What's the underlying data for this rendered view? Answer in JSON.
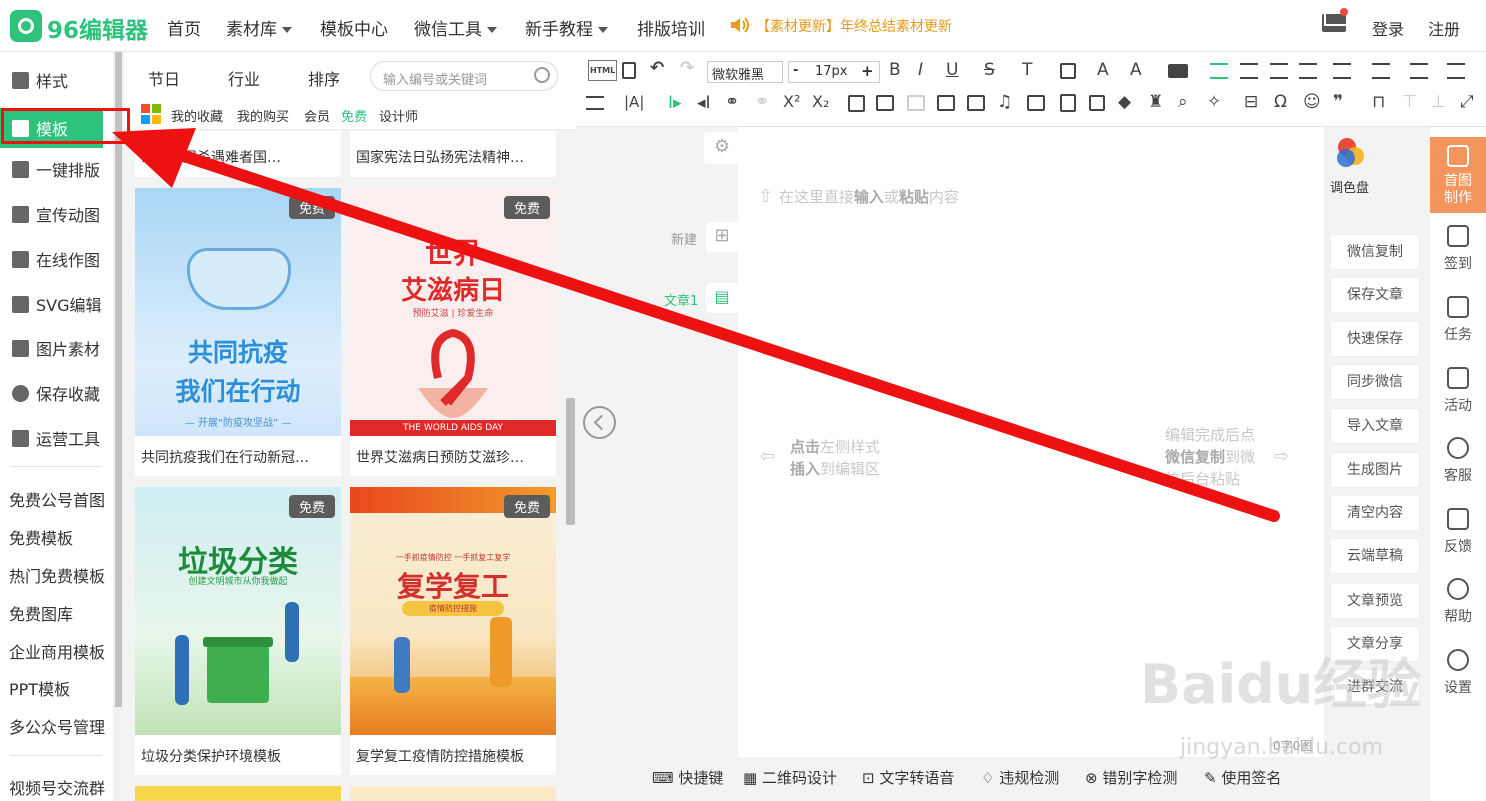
{
  "brand": {
    "logo_text": "96编辑器",
    "accent": "#2ec37c"
  },
  "topnav": {
    "items": [
      {
        "label": "首页",
        "dropdown": false
      },
      {
        "label": "素材库",
        "dropdown": true
      },
      {
        "label": "模板中心",
        "dropdown": false
      },
      {
        "label": "微信工具",
        "dropdown": true
      },
      {
        "label": "新手教程",
        "dropdown": true
      },
      {
        "label": "排版培训",
        "dropdown": false
      }
    ],
    "news": "【素材更新】年终总结素材更新",
    "login": "登录",
    "register": "注册"
  },
  "sidebar": {
    "items": [
      {
        "label": "样式",
        "icon": "grid-icon"
      },
      {
        "label": "模板",
        "icon": "layers-icon",
        "active": true
      },
      {
        "label": "一键排版",
        "icon": "copy-icon"
      },
      {
        "label": "宣传动图",
        "icon": "gif-icon"
      },
      {
        "label": "在线作图",
        "icon": "edit-icon"
      },
      {
        "label": "SVG编辑",
        "icon": "cursor-icon"
      },
      {
        "label": "图片素材",
        "icon": "image-icon"
      },
      {
        "label": "保存收藏",
        "icon": "heart-icon"
      },
      {
        "label": "运营工具",
        "icon": "apps-icon"
      }
    ],
    "links": [
      "免费公号首图",
      "免费模板",
      "热门免费模板",
      "免费图库",
      "企业商用模板",
      "PPT模板",
      "多公众号管理"
    ],
    "bottom_link": "视频号交流群"
  },
  "template_panel": {
    "tabs": [
      "节日",
      "行业",
      "排序"
    ],
    "search_placeholder": "输入编号或关键词",
    "subtabs": [
      "我的收藏",
      "我的购买",
      "会员",
      "免费",
      "设计师"
    ],
    "top_cards": [
      "…京大屠杀遇难者国…",
      "国家宪法日弘扬宪法精神…"
    ],
    "cards": [
      {
        "title": "共同抗疫我们在行动新冠…",
        "badge": "免费",
        "poster_title": "共同抗疫",
        "poster_title2": "我们在行动",
        "poster_sub": "— 开展“防疫攻坚战” —"
      },
      {
        "title": "世界艾滋病日预防艾滋珍…",
        "badge": "免费",
        "poster_title": "世界",
        "poster_title2": "艾滋病日",
        "poster_sub": "预防艾滋 | 珍爱生命",
        "poster_band": "THE WORLD AIDS DAY"
      },
      {
        "title": "垃圾分类保护环境模板",
        "badge": "免费",
        "poster_title": "垃圾分类",
        "poster_sub": "创建文明城市从你我做起"
      },
      {
        "title": "复学复工疫情防控措施模板",
        "badge": "免费",
        "poster_title": "复学复工",
        "poster_top": "一手抓疫情防控 一手抓复工复学",
        "poster_sub": "疫情防控措施"
      }
    ]
  },
  "toolbar": {
    "font_family": "微软雅黑",
    "font_size": "17px",
    "html_label": "HTML"
  },
  "editor": {
    "new_label": "新建",
    "article_label": "文章1",
    "top_hint_pre": "在这里直接",
    "top_hint_bold1": "输入",
    "top_hint_mid": "或",
    "top_hint_bold2": "粘贴",
    "top_hint_post": "内容",
    "left_hint_line1_bold": "点击",
    "left_hint_line1": "左侧样式",
    "left_hint_line2_bold": "插入",
    "left_hint_line2": "到编辑区",
    "right_hint_line1": "编辑完成后点",
    "right_hint_line2_bold": "微信复制",
    "right_hint_line2": "到微",
    "right_hint_line3": "信后台粘贴",
    "word_count": "0字0图"
  },
  "bottombar": [
    "快捷键",
    "二维码设计",
    "文字转语音",
    "违规检测",
    "错别字检测",
    "使用签名"
  ],
  "right_actions": [
    "微信复制",
    "保存文章",
    "快速保存",
    "同步微信",
    "导入文章",
    "生成图片",
    "清空内容",
    "云端草稿",
    "文章预览",
    "文章分享",
    "进群交流"
  ],
  "palette_label": "调色盘",
  "right_nav": [
    {
      "label": "首图\n制作",
      "active": true
    },
    {
      "label": "签到"
    },
    {
      "label": "任务"
    },
    {
      "label": "活动"
    },
    {
      "label": "客服"
    },
    {
      "label": "反馈"
    },
    {
      "label": "帮助"
    },
    {
      "label": "设置"
    }
  ],
  "watermark": {
    "text": "Baidu经验",
    "url": "jingyan.baidu.com"
  },
  "annotation_color": "#ee1111"
}
